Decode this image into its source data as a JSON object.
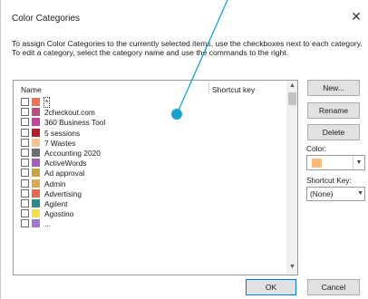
{
  "dialog": {
    "title": "Color Categories",
    "close_glyph": "✕",
    "instructions": "To assign Color Categories to the currently selected items, use the checkboxes next to each category. To edit a category, select the category name and use the commands to the right."
  },
  "list": {
    "header_name": "Name",
    "header_shortcut": "Shortcut key",
    "items": [
      {
        "label": "*",
        "color": "#e8735a",
        "new": true
      },
      {
        "label": "2checkout.com",
        "color": "#b5527b"
      },
      {
        "label": "360 Business Tool",
        "color": "#c3449b"
      },
      {
        "label": "5 sessions",
        "color": "#b01f2c"
      },
      {
        "label": "7 Wastes",
        "color": "#f6c490"
      },
      {
        "label": "Accounting 2020",
        "color": "#6f6f6f"
      },
      {
        "label": "ActiveWords",
        "color": "#a25fb8"
      },
      {
        "label": "Ad approval",
        "color": "#c6a53e"
      },
      {
        "label": "Admin",
        "color": "#d9a84f"
      },
      {
        "label": "Advertising",
        "color": "#e16b4c"
      },
      {
        "label": "Agilent",
        "color": "#2f8a8e"
      },
      {
        "label": "Agostino",
        "color": "#f3e04a"
      },
      {
        "label": "...",
        "color": "#9b7ac8"
      }
    ],
    "scroll_up": "▲",
    "scroll_down": "▼"
  },
  "buttons": {
    "new": "New...",
    "rename": "Rename",
    "delete": "Delete",
    "ok": "OK",
    "cancel": "Cancel"
  },
  "color": {
    "label": "Color:",
    "value": "#f7bd7e",
    "drop_glyph": "▼"
  },
  "shortcut": {
    "label": "Shortcut Key:",
    "value": "(None)",
    "drop_glyph": "▼"
  },
  "annotation": {
    "color": "#1aa3c9"
  }
}
